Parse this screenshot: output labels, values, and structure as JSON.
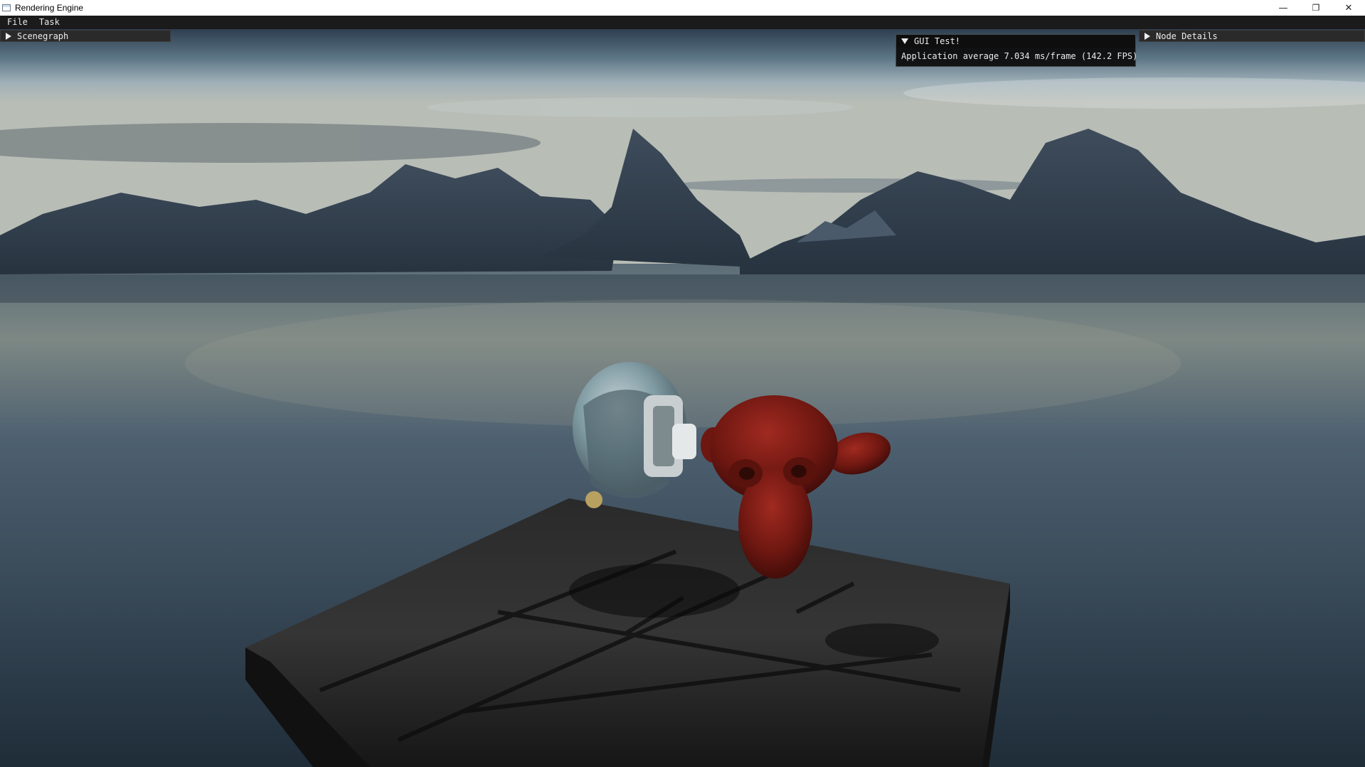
{
  "window": {
    "title": "Rendering Engine",
    "controls": {
      "minimize": "—",
      "maximize": "❐",
      "close": "✕"
    }
  },
  "menubar": {
    "items": [
      "File",
      "Task"
    ]
  },
  "panels": {
    "scenegraph": {
      "label": "Scenegraph",
      "expanded": false
    },
    "gui_test": {
      "label": "GUI Test!",
      "expanded": true,
      "stats_text": "Application average 7.034 ms/frame (142.2 FPS)"
    },
    "node_details": {
      "label": "Node Details",
      "expanded": false
    }
  },
  "scene": {
    "sky_color": "#8fa3b1",
    "water_color": "#2c3f4f",
    "mountain_color": "#2f3f52",
    "platform_color": "#1e1e1e",
    "helmet_color": "#8aa1a8",
    "monkey_color": "#7a1812"
  }
}
